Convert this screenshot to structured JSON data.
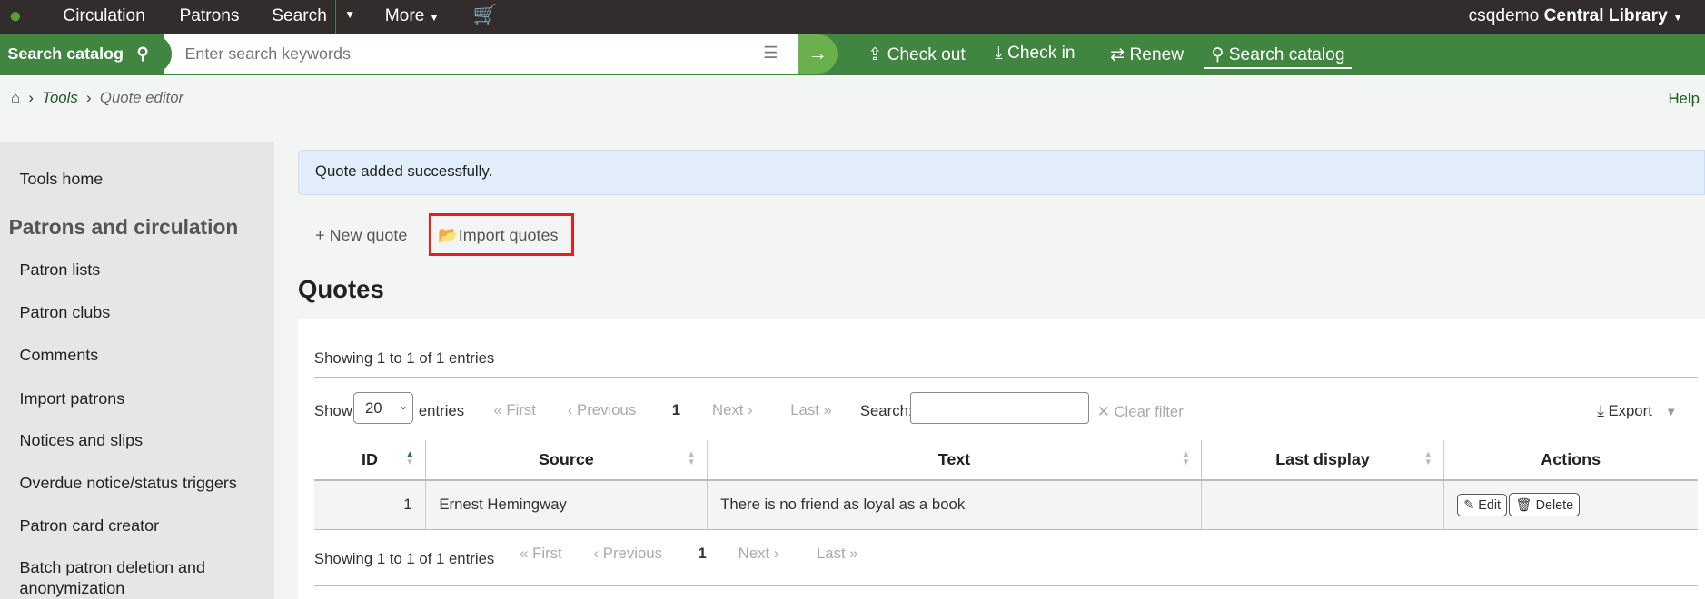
{
  "nav": {
    "items": [
      "Circulation",
      "Patrons",
      "Search",
      "More"
    ],
    "user": "csqdemo",
    "library": "Central Library"
  },
  "catalog": {
    "label": "Search catalog",
    "placeholder": "Enter search keywords",
    "actions": [
      "Check out",
      "Check in",
      "Renew",
      "Search catalog"
    ]
  },
  "breadcrumb": {
    "tools": "Tools",
    "current": "Quote editor",
    "help": "Help"
  },
  "sidebar": {
    "home": "Tools home",
    "heading": "Patrons and circulation",
    "items": [
      "Patron lists",
      "Patron clubs",
      "Comments",
      "Import patrons",
      "Notices and slips",
      "Overdue notice/status triggers",
      "Patron card creator",
      "Batch patron deletion and",
      "anonymization"
    ]
  },
  "alert": "Quote added successfully.",
  "toolbar": {
    "new": "New quote",
    "import": "Import quotes"
  },
  "title": "Quotes",
  "table": {
    "info": "Showing 1 to 1 of 1 entries",
    "show": "Show",
    "length": "20",
    "entries": "entries",
    "first": "First",
    "previous": "Previous",
    "page": "1",
    "next": "Next",
    "last": "Last",
    "search": "Search:",
    "clear": "Clear filter",
    "export": "Export",
    "headers": [
      "ID",
      "Source",
      "Text",
      "Last display",
      "Actions"
    ],
    "rows": [
      {
        "id": "1",
        "source": "Ernest Hemingway",
        "text": "There is no friend as loyal as a book",
        "last_display": "",
        "edit": "Edit",
        "delete": "Delete"
      }
    ]
  }
}
